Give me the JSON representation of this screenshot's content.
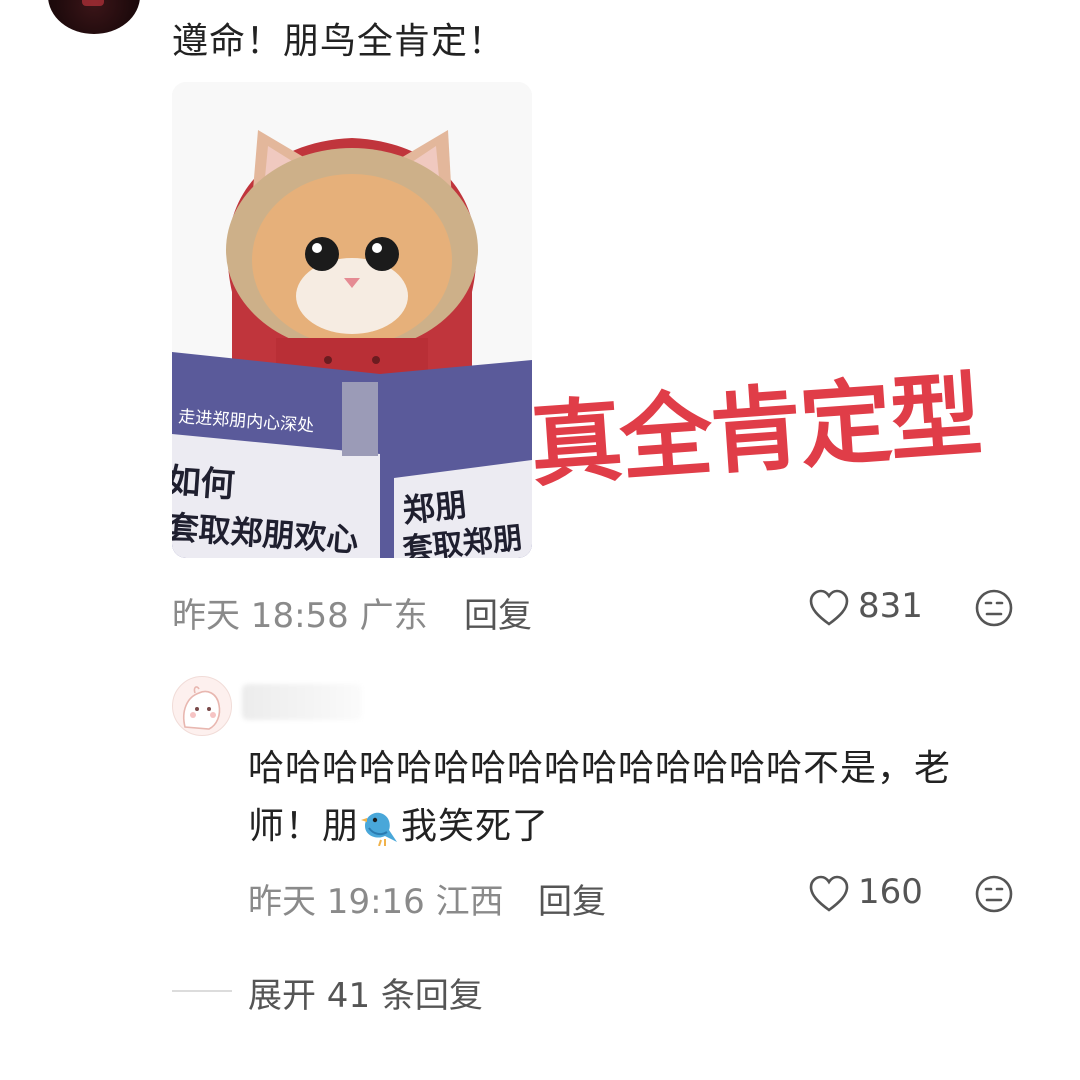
{
  "comment": {
    "text": "遵命！朋鸟全肯定！",
    "meme": {
      "book_banner": "走进郑朋内心深处",
      "book_title_line1": "如何",
      "book_title_line2": "套取郑朋欢心",
      "book_right_line1": "郑朋",
      "book_right_line2": "套取郑朋",
      "sticker": "真全肯定型"
    },
    "time": "昨天 18:58",
    "location": "广东",
    "reply_label": "回复",
    "like_count": "831"
  },
  "reply": {
    "text_line1": "哈哈哈哈哈哈哈哈哈哈哈哈哈哈哈不是，老",
    "text_line2_a": "师！朋",
    "text_line2_b": "我笑死了",
    "time": "昨天 19:16",
    "location": "江西",
    "reply_label": "回复",
    "like_count": "160"
  },
  "expand_label": "展开 41 条回复",
  "colors": {
    "sticker_red": "#e03d48",
    "book_purple": "#5a5a9a",
    "hood_red": "#c0353c"
  },
  "icons": [
    "heart-icon",
    "neutral-face-icon",
    "bird-emoji-icon"
  ]
}
